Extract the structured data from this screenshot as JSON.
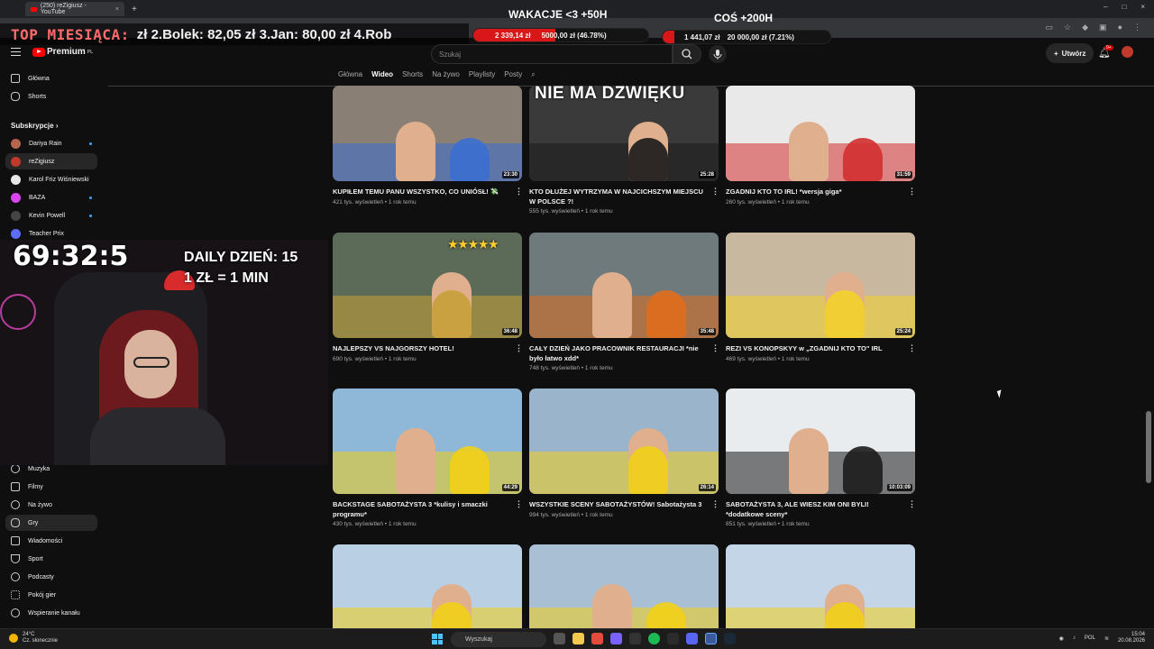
{
  "browser": {
    "tab_title": "(250) reZigiusz - YouTube",
    "new_tab": "+",
    "close": "×",
    "window_controls": [
      "–",
      "□",
      "×"
    ]
  },
  "stream_overlay": {
    "top_label": "TOP MIESIĄCA:",
    "top_entries": "zł  2.Bolek: 82,05 zł  3.Jan: 80,00 zł  4.Rob",
    "goal1": {
      "label": "WAKACJE <3 +50H",
      "current": "2 339,14 zł",
      "target": "5000,00 zł (46.78%)",
      "progress": 0.4678
    },
    "goal2": {
      "label": "COŚ +200H",
      "current": "1 441,07 zł",
      "target": "20 000,00 zł (7.21%)",
      "progress": 0.0721
    },
    "timer": "69:32:5",
    "daily_line1": "DAILY DZIEŃ: 15",
    "daily_line2": "1 ZŁ = 1 MIN"
  },
  "header": {
    "logo_text": "Premium",
    "logo_sup": "PL",
    "search_placeholder": "Szukaj",
    "create_label": "Utwórz",
    "notif_badge": "9+"
  },
  "sidebar": {
    "top": [
      {
        "label": "Główna",
        "icon": "home-icon"
      },
      {
        "label": "Shorts",
        "icon": "shorts-icon"
      }
    ],
    "subs_heading": "Subskrypcje",
    "subs": [
      {
        "label": "Dariya Rain",
        "color": "#b5654c"
      },
      {
        "label": "reZigiusz",
        "color": "#c0392b"
      },
      {
        "label": "Karol Friz Wiśniewski",
        "color": "#e8e8e8"
      },
      {
        "label": "BAZA",
        "color": "#d946ef"
      },
      {
        "label": "Kevin Powell",
        "color": "#444444"
      },
      {
        "label": "Teacher Prix",
        "color": "#5b6cff"
      }
    ],
    "explore": [
      {
        "label": "Muzyka",
        "icon": "music-icon"
      },
      {
        "label": "Filmy",
        "icon": "film-icon"
      },
      {
        "label": "Na żywo",
        "icon": "live-icon"
      },
      {
        "label": "Gry",
        "icon": "gamepad-icon"
      },
      {
        "label": "Wiadomości",
        "icon": "news-icon"
      },
      {
        "label": "Sport",
        "icon": "trophy-icon"
      },
      {
        "label": "Podcasty",
        "icon": "podcast-icon"
      },
      {
        "label": "Pokój gier",
        "icon": "game-room-icon"
      },
      {
        "label": "Wspieranie kanału",
        "icon": "support-icon"
      }
    ]
  },
  "channel_tabs": [
    "Główna",
    "Wideo",
    "Shorts",
    "Na żywo",
    "Playlisty",
    "Posty"
  ],
  "videos": [
    {
      "title": "KUPIŁEM TEMU PANU WSZYSTKO, CO UNIÓSŁ! 💸",
      "meta": "421 tys. wyświetleń • 1 rok temu",
      "duration": "23:30",
      "bg": "#8a7f74",
      "band": "#3b6fd1",
      "overlay": ""
    },
    {
      "title": "KTO DŁUŻEJ WYTRZYMA W NAJCICHSZYM MIEJSCU W POLSCE ?!",
      "meta": "555 tys. wyświetleń • 1 rok temu",
      "duration": "25:28",
      "bg": "#3a3a3a",
      "band": "#1a1a1a",
      "overlay": "NIE MA DŹWIĘKU"
    },
    {
      "title": "ZGADNIJ KTO TO IRL! *wersja giga*",
      "meta": "260 tys. wyświetleń • 1 rok temu",
      "duration": "31:59",
      "bg": "#e9e9e9",
      "band": "#d32f2f",
      "overlay": ""
    },
    {
      "title": "NAJLEPSZY VS NAJGORSZY HOTEL!",
      "meta": "690 tys. wyświetleń • 1 rok temu",
      "duration": "36:48",
      "bg": "#5c6b58",
      "band": "#c8a038",
      "overlay": "★★★★★"
    },
    {
      "title": "CAŁY DZIEŃ JAKO PRACOWNIK RESTAURACJI *nie było łatwo xdd*",
      "meta": "748 tys. wyświetleń • 1 rok temu",
      "duration": "35:48",
      "bg": "#6f7a7d",
      "band": "#e06d1d",
      "overlay": ""
    },
    {
      "title": "REZI VS KONOPSKYY w „ZGADNIJ KTO TO\" IRL",
      "meta": "469 tys. wyświetleń • 1 rok temu",
      "duration": "25:24",
      "bg": "#c9b8a0",
      "band": "#f3d12a",
      "overlay": ""
    },
    {
      "title": "BACKSTAGE SABOTAŻYSTA 3 *kulisy i smaczki programu*",
      "meta": "430 tys. wyświetleń • 1 rok temu",
      "duration": "44:29",
      "bg": "#8fb7d8",
      "band": "#f2d017",
      "overlay": ""
    },
    {
      "title": "WSZYSTKIE SCENY SABOTAŻYSTÓW! Sabotażysta 3",
      "meta": "994 tys. wyświetleń • 1 rok temu",
      "duration": "26:14",
      "bg": "#9ab4cc",
      "band": "#f2d017",
      "overlay": ""
    },
    {
      "title": "SABOTAŻYSTA 3, ALE WIESZ KIM ONI BYLI! *dodatkowe sceny*",
      "meta": "851 tys. wyświetleń • 1 rok temu",
      "duration": "10:03:09",
      "bg": "#e8ecef",
      "band": "#1c1c1c",
      "overlay": ""
    },
    {
      "title": "",
      "meta": "",
      "duration": "",
      "bg": "#b9cfe3",
      "band": "#f2d017",
      "overlay": ""
    },
    {
      "title": "",
      "meta": "",
      "duration": "",
      "bg": "#a9bfd4",
      "band": "#f2d017",
      "overlay": ""
    },
    {
      "title": "",
      "meta": "",
      "duration": "",
      "bg": "#c3d5e6",
      "band": "#f2d017",
      "overlay": ""
    }
  ],
  "taskbar": {
    "temp": "24°C",
    "weather": "Cz. słonecznie",
    "search": "Wyszukaj",
    "lang": "POL",
    "time": "15:04",
    "date": "20.08.2026"
  }
}
